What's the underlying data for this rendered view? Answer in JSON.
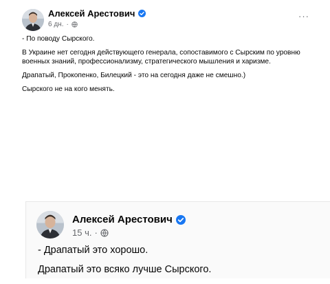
{
  "posts": [
    {
      "author": "Алексей Арестович",
      "time": "6 дн.",
      "more_label": "···",
      "paragraphs": [
        "- По поводу Сырского.",
        "В Украине нет сегодня действующего генерала, сопоставимого с Сырским по уровню военных знаний, профессионализму, стратегического мышления и харизме.",
        "Драпатый, Прокопенко, Билецкий - это на сегодня даже не смешно.)",
        "Сырского не на кого менять."
      ]
    },
    {
      "author": "Алексей Арестович",
      "time": "15 ч.",
      "paragraphs": [
        "- Драпатый это хорошо.",
        "Драпатый это всяко лучше Сырского."
      ]
    }
  ],
  "meta_separator": "·",
  "colors": {
    "verified": "#1877f2",
    "meta_text": "#65676b",
    "body_text": "#050505"
  },
  "icons": {
    "verified": "verified-badge-icon",
    "audience": "globe-icon",
    "menu": "more-options-icon"
  }
}
